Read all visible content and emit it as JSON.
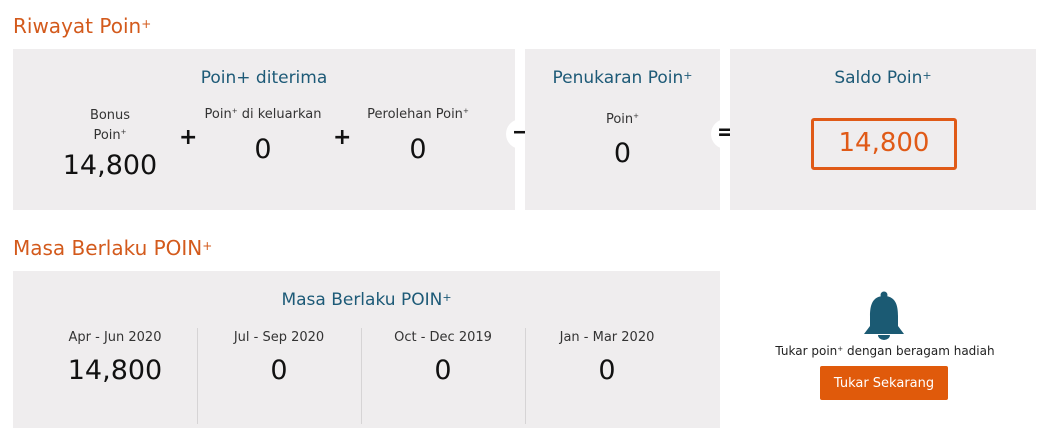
{
  "riwayat": {
    "title": "Riwayat Poin",
    "title_sup": "+",
    "received": {
      "heading": "Poin+ diterima",
      "bonus": {
        "label_line1": "Bonus",
        "label_line2": "Poin",
        "sup": "+",
        "value": "14,800"
      },
      "issued": {
        "label": "Poin",
        "sup": "+",
        "label_rest": " di keluarkan",
        "value": "0"
      },
      "earned": {
        "label": "Perolehan Poin",
        "sup": "+",
        "value": "0"
      },
      "plus_symbol": "+"
    },
    "redemption": {
      "heading": "Penukaran Poin",
      "heading_sup": "+",
      "label": "Poin",
      "sup": "+",
      "value": "0",
      "minus_symbol": "−"
    },
    "balance": {
      "heading": "Saldo Poin",
      "heading_sup": "+",
      "value": "14,800",
      "equals_symbol": "="
    }
  },
  "masa_berlaku": {
    "title": "Masa Berlaku POIN",
    "title_sup": "+",
    "panel_heading": "Masa Berlaku POIN",
    "panel_heading_sup": "+",
    "periods": [
      {
        "label": "Apr - Jun 2020",
        "value": "14,800"
      },
      {
        "label": "Jul - Sep 2020",
        "value": "0"
      },
      {
        "label": "Oct - Dec 2019",
        "value": "0"
      },
      {
        "label": "Jan - Mar 2020",
        "value": "0"
      }
    ]
  },
  "promo": {
    "icon": "bell-icon",
    "text_before": "Tukar poin",
    "text_sup": "+",
    "text_after": " dengan beragam hadiah",
    "button_label": "Tukar Sekarang"
  },
  "colors": {
    "accent": "#e05a17",
    "heading_blue": "#1d5a77",
    "panel_bg": "#efedee"
  }
}
